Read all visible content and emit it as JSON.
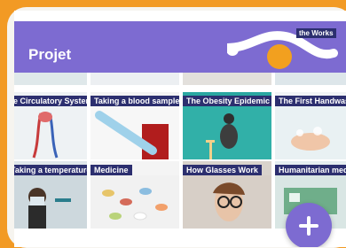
{
  "header": {
    "title": "Projet",
    "corner_text": "the Works"
  },
  "tiles": [
    {
      "label": "The Circulatory System Works"
    },
    {
      "label": "Taking a blood sample"
    },
    {
      "label": "The Obesity Epidemic"
    },
    {
      "label": "The First Handwashing Procedure"
    },
    {
      "label": "Taking a temperature"
    },
    {
      "label": "Medicine"
    },
    {
      "label": "How Glasses Work"
    },
    {
      "label": "Humanitarian medical clinic"
    }
  ],
  "colors": {
    "accent": "#7d6bd1",
    "frame": "#f29a24",
    "label_bg": "#2c2f6f",
    "dot": "#f2a01f"
  },
  "icons": {
    "fab": "plus-icon"
  }
}
